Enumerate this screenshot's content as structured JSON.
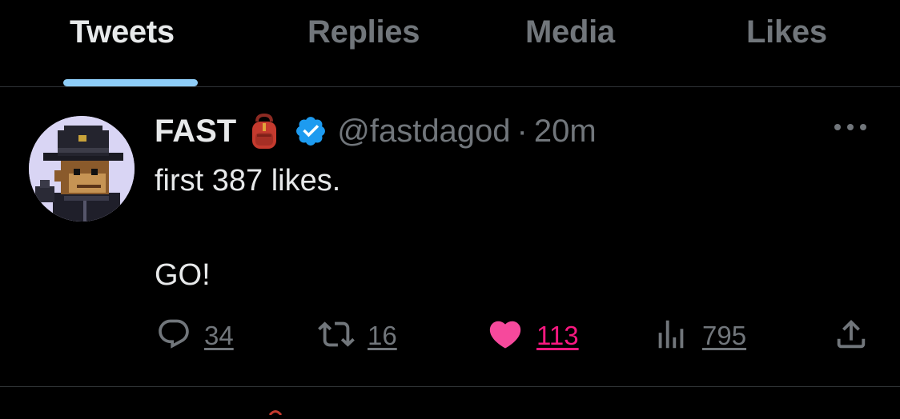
{
  "tabs": [
    {
      "label": "Tweets",
      "active": true
    },
    {
      "label": "Replies",
      "active": false
    },
    {
      "label": "Media",
      "active": false
    },
    {
      "label": "Likes",
      "active": false
    }
  ],
  "tweet": {
    "author_name": "FAST",
    "author_emoji": "backpack-emoji",
    "verified": true,
    "handle": "@fastdagod",
    "separator": "·",
    "time": "20m",
    "lines": [
      "first 387 likes.",
      "GO!"
    ],
    "actions": {
      "replies": "34",
      "retweets": "16",
      "likes": "113",
      "views": "795"
    },
    "liked": true
  },
  "colors": {
    "background": "#000000",
    "text": "#e7e9ea",
    "secondary": "#71767b",
    "accent": "#8ecdf8",
    "verified": "#1d9bf0",
    "like": "#f91880"
  }
}
